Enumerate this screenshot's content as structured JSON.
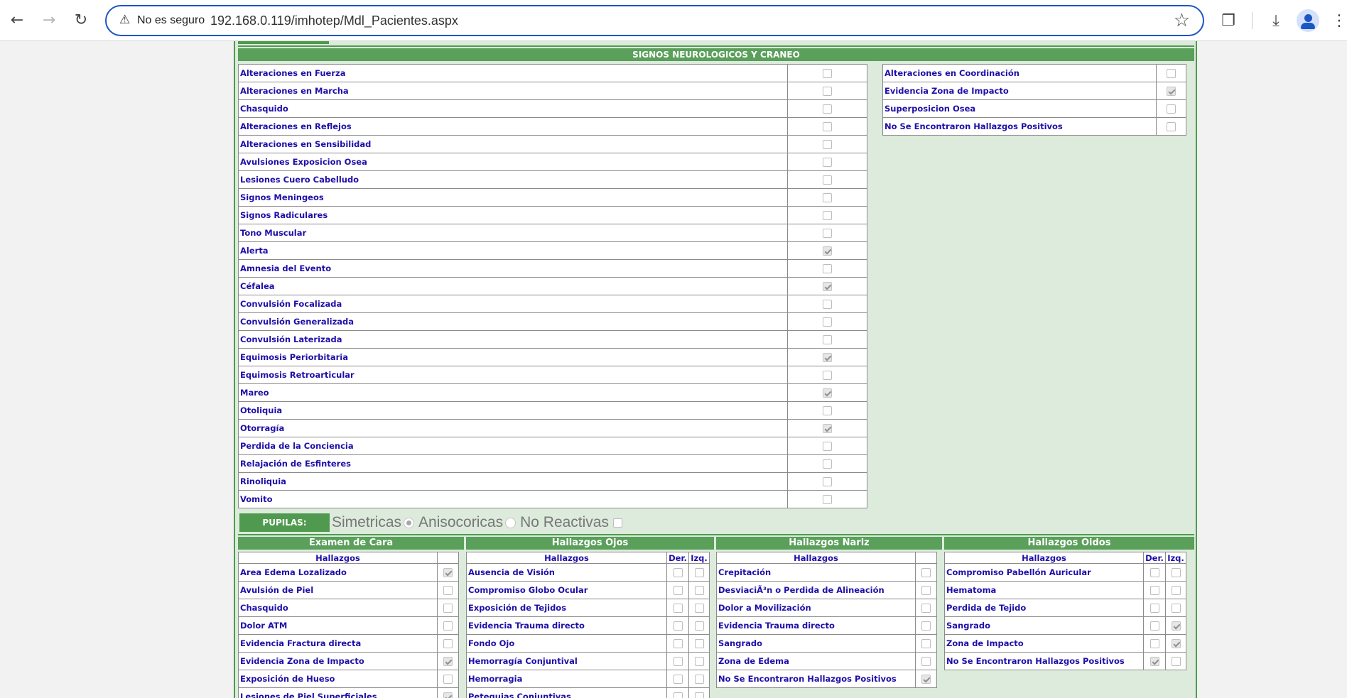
{
  "browser": {
    "security_icon": "warning-triangle-icon",
    "security_label": "No es seguro",
    "url": "192.168.0.119/imhotep/Mdl_Pacientes.aspx"
  },
  "section": {
    "title": "SIGNOS NEUROLOGICOS Y CRANEO",
    "left_items": [
      {
        "label": "Alteraciones en Fuerza",
        "checked": false
      },
      {
        "label": "Alteraciones en Marcha",
        "checked": false
      },
      {
        "label": "Chasquido",
        "checked": false
      },
      {
        "label": "Alteraciones en Reflejos",
        "checked": false
      },
      {
        "label": "Alteraciones en Sensibilidad",
        "checked": false
      },
      {
        "label": "Avulsiones Exposicion Osea",
        "checked": false
      },
      {
        "label": "Lesiones Cuero Cabelludo",
        "checked": false
      },
      {
        "label": "Signos Meningeos",
        "checked": false
      },
      {
        "label": "Signos Radiculares",
        "checked": false
      },
      {
        "label": "Tono Muscular",
        "checked": false
      },
      {
        "label": "Alerta",
        "checked": true
      },
      {
        "label": "Amnesia del Evento",
        "checked": false
      },
      {
        "label": "Céfalea",
        "checked": true
      },
      {
        "label": "Convulsión Focalizada",
        "checked": false
      },
      {
        "label": "Convulsión Generalizada",
        "checked": false
      },
      {
        "label": "Convulsión Laterizada",
        "checked": false
      },
      {
        "label": "Equimosis Periorbitaria",
        "checked": true
      },
      {
        "label": "Equimosis Retroarticular",
        "checked": false
      },
      {
        "label": "Mareo",
        "checked": true
      },
      {
        "label": "Otoliquia",
        "checked": false
      },
      {
        "label": "Otorragía",
        "checked": true
      },
      {
        "label": "Perdida de la Conciencia",
        "checked": false
      },
      {
        "label": "Relajación de Esfinteres",
        "checked": false
      },
      {
        "label": "Rinoliquia",
        "checked": false
      },
      {
        "label": "Vomito",
        "checked": false
      }
    ],
    "right_items": [
      {
        "label": "Alteraciones en Coordinación",
        "checked": false
      },
      {
        "label": "Evidencia Zona de Impacto",
        "checked": true
      },
      {
        "label": "Superposicion Osea",
        "checked": false
      },
      {
        "label": "No Se Encontraron Hallazgos Positivos",
        "checked": false
      }
    ]
  },
  "pupilas": {
    "label": "PUPILAS:",
    "options": [
      {
        "label": "Simetricas",
        "selected": true
      },
      {
        "label": "Anisocoricas",
        "selected": false
      },
      {
        "label": "No Reactivas",
        "selected": false
      }
    ]
  },
  "cara": {
    "title": "Examen de Cara",
    "col_header": "Hallazgos",
    "rows": [
      {
        "label": "Area Edema Lozalizado",
        "checked": true
      },
      {
        "label": "Avulsión de Piel",
        "checked": false
      },
      {
        "label": "Chasquido",
        "checked": false
      },
      {
        "label": "Dolor ATM",
        "checked": false
      },
      {
        "label": "Evidencia Fractura directa",
        "checked": false
      },
      {
        "label": "Evidencia Zona de Impacto",
        "checked": true
      },
      {
        "label": "Exposición de Hueso",
        "checked": false
      },
      {
        "label": "Lesiones de Piel Superficiales",
        "checked": true
      }
    ]
  },
  "ojos": {
    "title": "Hallazgos Ojos",
    "col_header": "Hallazgos",
    "der": "Der.",
    "izq": "Izq.",
    "rows": [
      {
        "label": "Ausencia de Visión",
        "der": false,
        "izq": false
      },
      {
        "label": "Compromiso Globo Ocular",
        "der": false,
        "izq": false
      },
      {
        "label": "Exposición de Tejidos",
        "der": false,
        "izq": false
      },
      {
        "label": "Evidencia Trauma directo",
        "der": false,
        "izq": false
      },
      {
        "label": "Fondo Ojo",
        "der": false,
        "izq": false
      },
      {
        "label": "Hemorragía Conjuntival",
        "der": false,
        "izq": false
      },
      {
        "label": "Hemorragia",
        "der": false,
        "izq": false
      },
      {
        "label": "Petequias Conjuntivas",
        "der": false,
        "izq": false
      }
    ]
  },
  "nariz": {
    "title": "Hallazgos Nariz",
    "col_header": "Hallazgos",
    "rows": [
      {
        "label": "Crepitación",
        "checked": false
      },
      {
        "label": "DesviaciÃ³n o Perdida de Alineación",
        "checked": false
      },
      {
        "label": "Dolor a Movilización",
        "checked": false
      },
      {
        "label": "Evidencia Trauma directo",
        "checked": false
      },
      {
        "label": "Sangrado",
        "checked": false
      },
      {
        "label": "Zona de Edema",
        "checked": false
      },
      {
        "label": "No Se Encontraron Hallazgos Positivos",
        "checked": true
      }
    ]
  },
  "oidos": {
    "title": "Hallazgos Oidos",
    "col_header": "Hallazgos",
    "der": "Der.",
    "izq": "Izq.",
    "rows": [
      {
        "label": "Compromiso Pabellón Auricular",
        "der": false,
        "izq": false
      },
      {
        "label": "Hematoma",
        "der": false,
        "izq": false
      },
      {
        "label": "Perdida de Tejido",
        "der": false,
        "izq": false
      },
      {
        "label": "Sangrado",
        "der": false,
        "izq": true
      },
      {
        "label": "Zona de Impacto",
        "der": false,
        "izq": true
      },
      {
        "label": "No Se Encontraron Hallazgos Positivos",
        "der": true,
        "izq": false
      }
    ]
  }
}
